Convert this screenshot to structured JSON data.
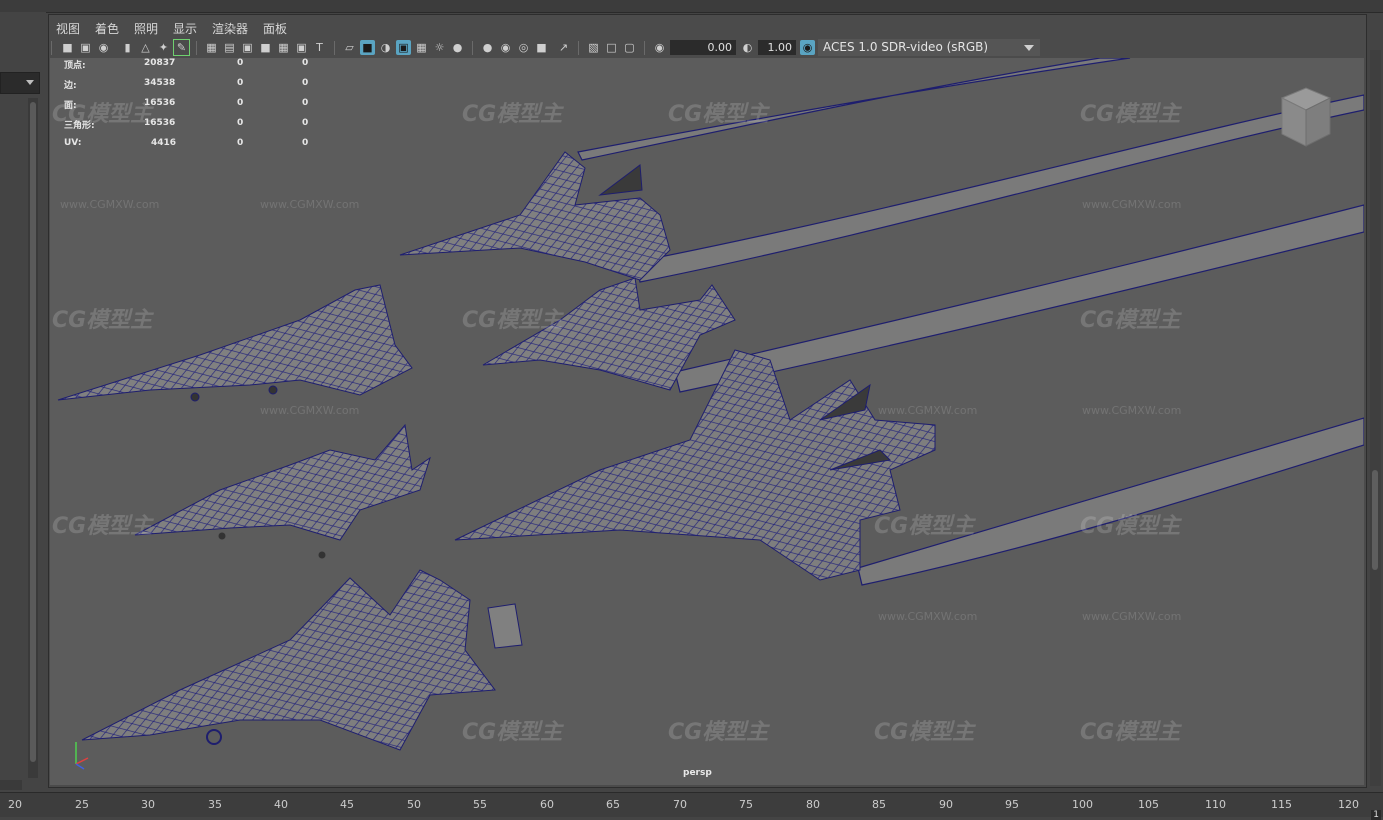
{
  "menu": {
    "items": [
      "视图",
      "着色",
      "照明",
      "显示",
      "渲染器",
      "面板"
    ]
  },
  "toolbar": {
    "exposure": "0.00",
    "gamma": "1.00",
    "color_space": "ACES 1.0 SDR-video (sRGB)"
  },
  "hud": {
    "rows": [
      {
        "label": "顶点:",
        "v1": "20837",
        "v2": "0",
        "v3": "0"
      },
      {
        "label": "边:",
        "v1": "34538",
        "v2": "0",
        "v3": "0"
      },
      {
        "label": "面:",
        "v1": "16536",
        "v2": "0",
        "v3": "0"
      },
      {
        "label": "三角形:",
        "v1": "16536",
        "v2": "0",
        "v3": "0"
      },
      {
        "label": "UV:",
        "v1": "4416",
        "v2": "0",
        "v3": "0"
      }
    ]
  },
  "viewport": {
    "camera_label": "persp"
  },
  "watermark": {
    "logo": "CG模型主",
    "url": "www.CGMXW.com"
  },
  "timeline": {
    "ticks": [
      "20",
      "25",
      "30",
      "35",
      "40",
      "45",
      "50",
      "55",
      "60",
      "65",
      "70",
      "75",
      "80",
      "85",
      "90",
      "95",
      "100",
      "105",
      "110",
      "115",
      "120"
    ],
    "current_frame": "1"
  },
  "colors": {
    "wire": "#1e1e6e",
    "mesh_fill": "#777777",
    "viewport_bg": "#5c5c5c",
    "active_icon": "#5aa4c2"
  },
  "icons": [
    "camera-icon",
    "bookmark-icon",
    "grid-icon",
    "wireframe-icon",
    "smooth-shade-icon",
    "texture-icon",
    "light-icon",
    "shadow-icon",
    "isolate-icon",
    "xray-icon",
    "resolution-gate-icon",
    "exposure-icon",
    "gamma-icon",
    "viewcube-icon"
  ]
}
